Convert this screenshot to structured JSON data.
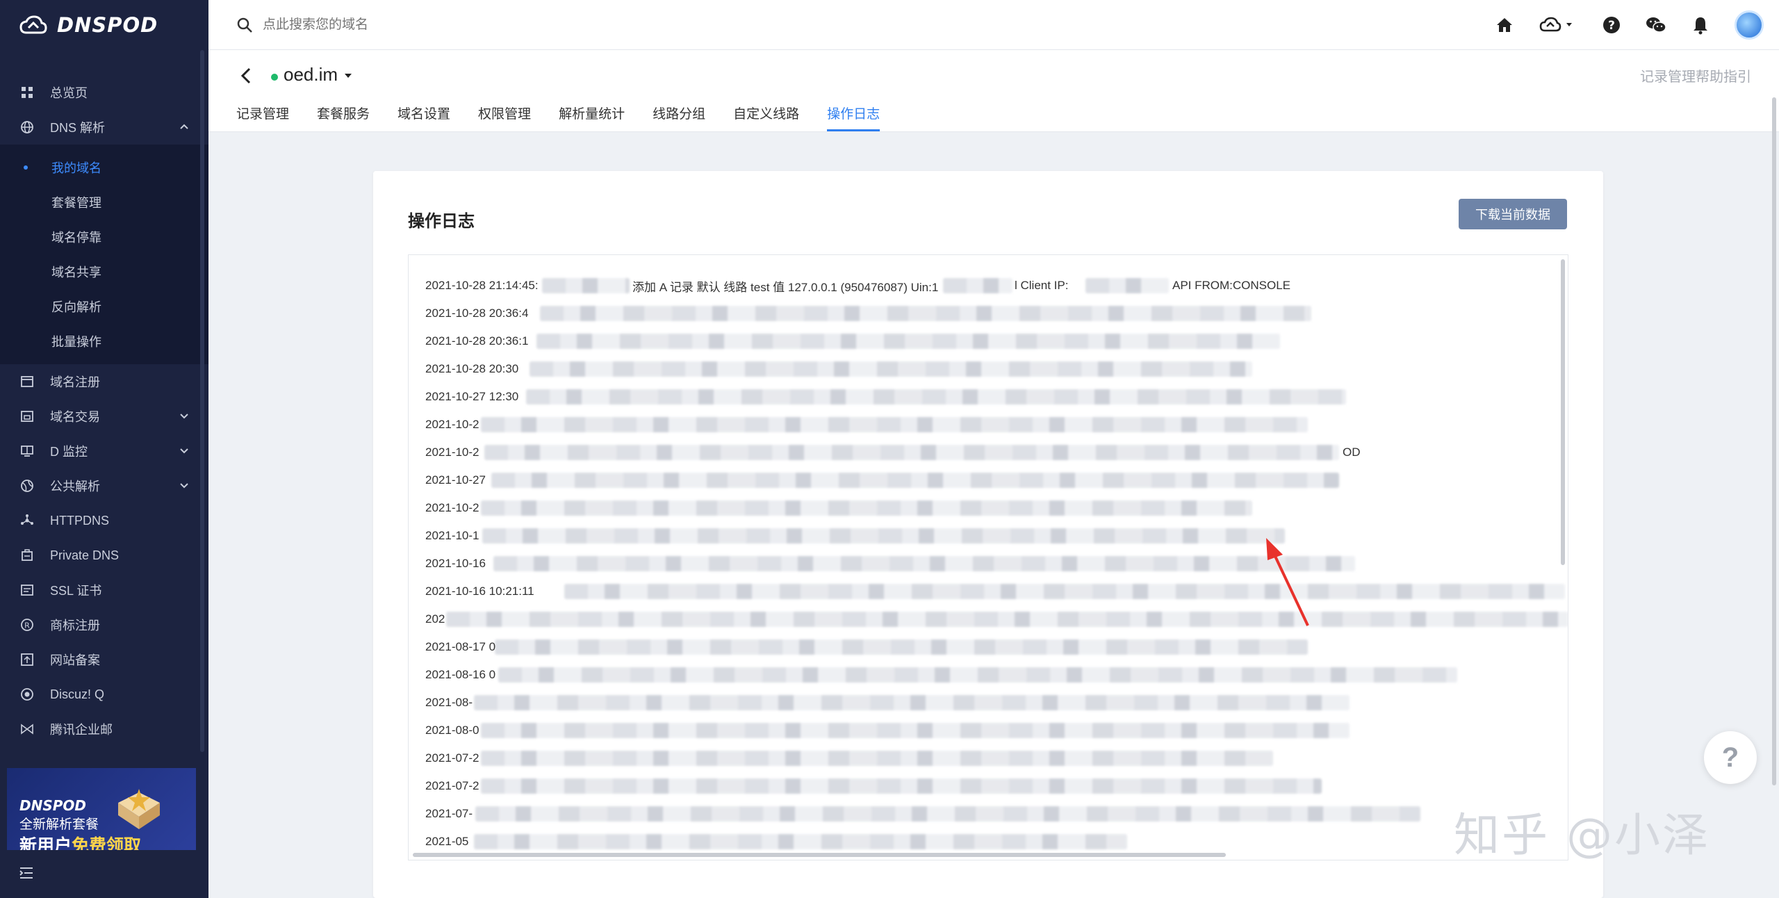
{
  "brand": {
    "name": "DNSPOD"
  },
  "sidebar": {
    "items": [
      {
        "label": "总览页",
        "icon": "grid-icon"
      },
      {
        "label": "DNS 解析",
        "icon": "globe-icon",
        "expanded": true
      },
      {
        "label": "域名注册",
        "icon": "window-icon"
      },
      {
        "label": "域名交易",
        "icon": "store-icon"
      },
      {
        "label": "D 监控",
        "icon": "monitor-icon"
      },
      {
        "label": "公共解析",
        "icon": "public-globe-icon"
      },
      {
        "label": "HTTPDNS",
        "icon": "nodes-icon"
      },
      {
        "label": "Private DNS",
        "icon": "server-icon"
      },
      {
        "label": "SSL 证书",
        "icon": "certificate-icon"
      },
      {
        "label": "商标注册",
        "icon": "registered-icon"
      },
      {
        "label": "网站备案",
        "icon": "record-icon"
      },
      {
        "label": "Discuz! Q",
        "icon": "discuz-icon"
      },
      {
        "label": "腾讯企业邮",
        "icon": "mail-icon"
      }
    ],
    "dns_sub": [
      "我的域名",
      "套餐管理",
      "域名停靠",
      "域名共享",
      "反向解析",
      "批量操作"
    ],
    "promo": {
      "brand": "DNSPOD",
      "line1": "全新解析套餐",
      "line2a": "新用户",
      "line2b": "免费领取"
    }
  },
  "search": {
    "placeholder": "点此搜索您的域名"
  },
  "domain": {
    "name": "oed.im",
    "help_link": "记录管理帮助指引"
  },
  "tabs": [
    "记录管理",
    "套餐服务",
    "域名设置",
    "权限管理",
    "解析量统计",
    "线路分组",
    "自定义线路",
    "操作日志"
  ],
  "log": {
    "title": "操作日志",
    "download_label": "下载当前数据",
    "first_row": {
      "timestamp": "2021-10-28 21:14:45:",
      "text": "添加 A 记录 默认 线路 test 值 127.0.0.1 (950476087) Uin:1",
      "client": "l Client IP:",
      "tail": "API FROM:CONSOLE"
    },
    "rows": [
      "2021-10-28 20:36:4",
      "2021-10-28 20:36:1",
      "2021-10-28 20:30",
      "2021-10-27 12:30",
      "2021-10-2",
      "2021-10-2",
      "2021-10-27",
      "2021-10-2",
      "2021-10-1",
      "2021-10-16",
      "2021-10-16 10:21:11",
      "202",
      "2021-08-17 0",
      "2021-08-16 0",
      "2021-08-",
      "2021-08-0",
      "2021-07-2",
      "2021-07-2",
      "2021-07-",
      "2021-05"
    ],
    "row6_tail": "OD"
  },
  "watermark": "知乎 @小泽",
  "colors": {
    "sidebar_bg": "#1c2340",
    "accent": "#2f7ff0",
    "button": "#6e84a8"
  }
}
